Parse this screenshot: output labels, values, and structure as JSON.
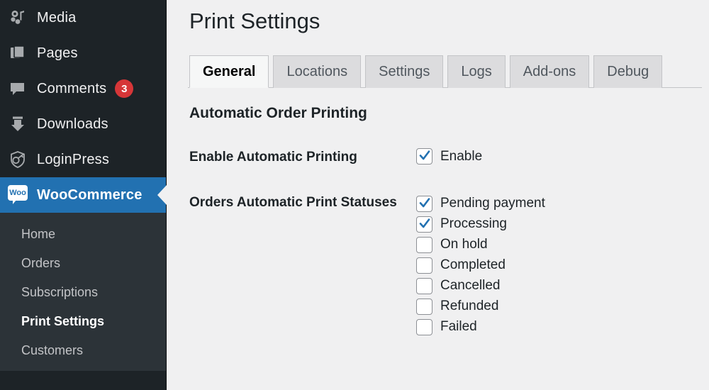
{
  "sidebar": {
    "menu": [
      {
        "label": "Media",
        "icon": "media-icon",
        "current": false,
        "badge": null
      },
      {
        "label": "Pages",
        "icon": "pages-icon",
        "current": false,
        "badge": null
      },
      {
        "label": "Comments",
        "icon": "comments-icon",
        "current": false,
        "badge": "3"
      },
      {
        "label": "Downloads",
        "icon": "downloads-icon",
        "current": false,
        "badge": null
      },
      {
        "label": "LoginPress",
        "icon": "loginpress-icon",
        "current": false,
        "badge": null
      },
      {
        "label": "WooCommerce",
        "icon": "woocommerce-icon",
        "current": true,
        "badge": null
      }
    ],
    "submenu": [
      {
        "label": "Home",
        "current": false
      },
      {
        "label": "Orders",
        "current": false
      },
      {
        "label": "Subscriptions",
        "current": false
      },
      {
        "label": "Print Settings",
        "current": true
      },
      {
        "label": "Customers",
        "current": false
      }
    ],
    "woo_icon_text": "Woo"
  },
  "header": {
    "title": "Print Settings"
  },
  "tabs": [
    {
      "label": "General",
      "active": true
    },
    {
      "label": "Locations",
      "active": false
    },
    {
      "label": "Settings",
      "active": false
    },
    {
      "label": "Logs",
      "active": false
    },
    {
      "label": "Add-ons",
      "active": false
    },
    {
      "label": "Debug",
      "active": false
    }
  ],
  "main": {
    "section_title": "Automatic Order Printing",
    "enable_row": {
      "label": "Enable Automatic Printing",
      "checkbox": {
        "label": "Enable",
        "checked": true
      }
    },
    "statuses_row": {
      "label": "Orders Automatic Print Statuses",
      "checkboxes": [
        {
          "label": "Pending payment",
          "checked": true
        },
        {
          "label": "Processing",
          "checked": true
        },
        {
          "label": "On hold",
          "checked": false
        },
        {
          "label": "Completed",
          "checked": false
        },
        {
          "label": "Cancelled",
          "checked": false
        },
        {
          "label": "Refunded",
          "checked": false
        },
        {
          "label": "Failed",
          "checked": false
        }
      ]
    }
  },
  "colors": {
    "sidebar_bg": "#1d2327",
    "submenu_bg": "#2c3338",
    "accent_blue": "#2271b1",
    "badge_red": "#d63638",
    "content_bg": "#f0f0f1",
    "checkbox_tick": "#2271b1"
  }
}
